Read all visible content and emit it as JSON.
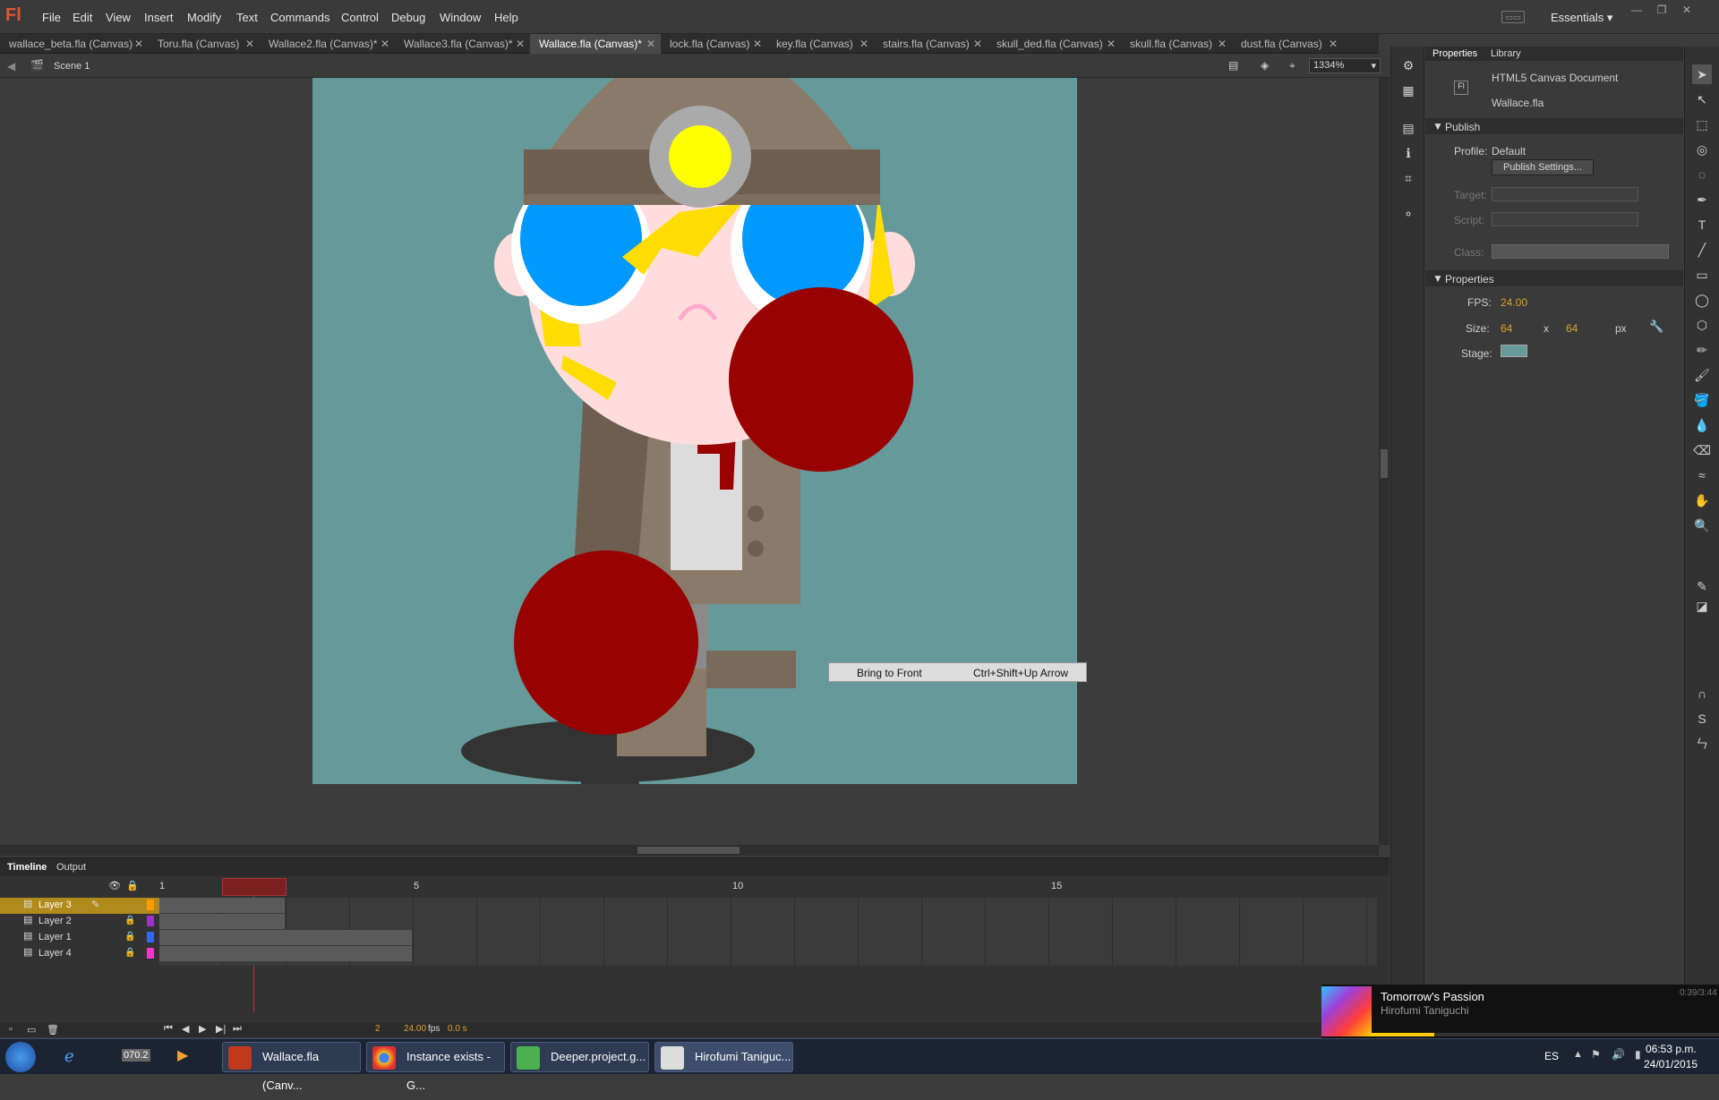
{
  "app": {
    "logo": "Fl"
  },
  "menu": [
    "File",
    "Edit",
    "View",
    "Insert",
    "Modify",
    "Text",
    "Commands",
    "Control",
    "Debug",
    "Window",
    "Help"
  ],
  "workspace": {
    "label": "Essentials"
  },
  "tabs": [
    {
      "label": "wallace_beta.fla (Canvas)",
      "active": false
    },
    {
      "label": "Toru.fla (Canvas)",
      "active": false
    },
    {
      "label": "Wallace2.fla (Canvas)*",
      "active": false
    },
    {
      "label": "Wallace3.fla (Canvas)*",
      "active": false
    },
    {
      "label": "Wallace.fla (Canvas)*",
      "active": true
    },
    {
      "label": "lock.fla (Canvas)",
      "active": false
    },
    {
      "label": "key.fla (Canvas)",
      "active": false
    },
    {
      "label": "stairs.fla (Canvas)",
      "active": false
    },
    {
      "label": "skull_ded.fla (Canvas)",
      "active": false
    },
    {
      "label": "skull.fla (Canvas)",
      "active": false
    },
    {
      "label": "dust.fla (Canvas)",
      "active": false
    }
  ],
  "scene": {
    "label": "Scene 1",
    "zoom": "1334%"
  },
  "context_menu": {
    "label": "Bring to Front",
    "shortcut": "Ctrl+Shift+Up Arrow"
  },
  "timeline": {
    "tabs": [
      "Timeline",
      "Output"
    ],
    "frame_markers": [
      "1",
      "5",
      "10",
      "15"
    ],
    "layers": [
      "Layer 3",
      "Layer 2",
      "Layer 1",
      "Layer 4"
    ],
    "current_frame": "2",
    "fps": "24.00",
    "fps_unit": "fps",
    "time": "0.0 s"
  },
  "properties": {
    "tabs": [
      "Properties",
      "Library"
    ],
    "doc_type": "HTML5 Canvas Document",
    "doc_name": "Wallace.fla",
    "publish_header": "Publish",
    "profile_label": "Profile:",
    "profile_value": "Default",
    "publish_settings": "Publish Settings...",
    "target_label": "Target:",
    "script_label": "Script:",
    "class_label": "Class:",
    "props_header": "Properties",
    "fps_label": "FPS:",
    "fps_value": "24.00",
    "size_label": "Size:",
    "width": "64",
    "x": "x",
    "height": "64",
    "unit": "px",
    "stage_label": "Stage:",
    "stage_color": "#669999"
  },
  "music": {
    "title": "Tomorrow's Passion",
    "artist": "Hirofumi Taniguchi",
    "time": "0:39/3:44"
  },
  "taskbar": {
    "items": [
      "Wallace.fla (Canv...",
      "Instance exists - G...",
      "Deeper.project.g...",
      "Hirofumi Taniguc..."
    ],
    "lang": "ES",
    "clock_time": "06:53 p.m.",
    "clock_date": "24/01/2015",
    "quick_label": "070.2"
  },
  "colors": {
    "accent": "#e0552b",
    "stage": "#669999",
    "ball": "#990000",
    "hair": "#ffdd00",
    "eyes": "#0099ff"
  }
}
